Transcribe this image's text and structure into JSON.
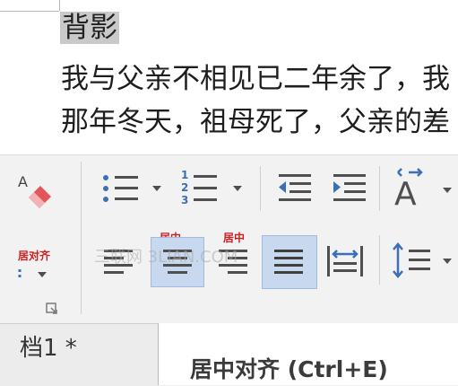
{
  "document": {
    "title": "背影",
    "lines": [
      "我与父亲不相见已二年余了，我",
      "那年冬天，祖母死了，父亲的差"
    ]
  },
  "ribbon": {
    "labels": {
      "align_left_partial": "居对齐",
      "center_1": "居中",
      "center_2": "居中"
    },
    "watermark": "三联网 3LIAN.COM",
    "icons": [
      "text-style-icon",
      "bullets-icon",
      "numbering-icon",
      "decrease-indent-icon",
      "increase-indent-icon",
      "font-size-icon",
      "align-left-icon",
      "align-center-icon",
      "align-right-icon",
      "justify-icon",
      "distributed-icon",
      "line-spacing-icon",
      "dialog-launcher-icon"
    ]
  },
  "statusbar": {
    "doc_tab": "档1 *"
  },
  "tooltip": {
    "text": "居中对齐 (Ctrl+E)"
  },
  "colors": {
    "highlight": "#c8d8ef",
    "label_red": "#cc1f1f",
    "icon_blue": "#3b6fb6"
  }
}
